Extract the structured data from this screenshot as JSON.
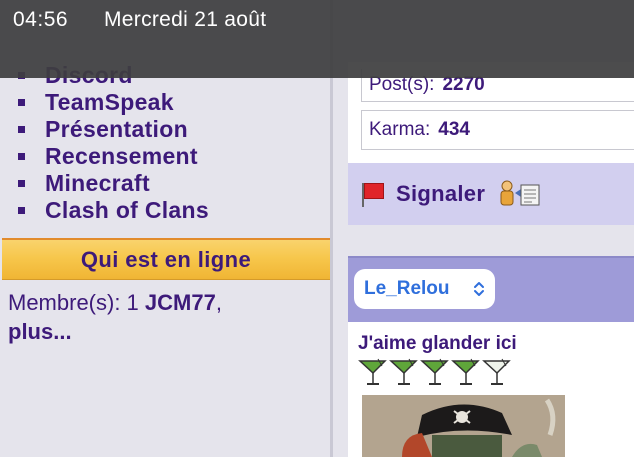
{
  "status_bar": {
    "time": "04:56",
    "date": "Mercredi 21 août"
  },
  "sidebar": {
    "items": [
      {
        "label": "Discord"
      },
      {
        "label": "TeamSpeak"
      },
      {
        "label": "Présentation"
      },
      {
        "label": "Recensement"
      },
      {
        "label": "Minecraft"
      },
      {
        "label": "Clash of Clans"
      }
    ]
  },
  "online": {
    "title": "Qui est en ligne",
    "members_label": "Membre(s): 1",
    "member_name": "JCM77",
    "separator": ",",
    "more_link": "plus..."
  },
  "profile": {
    "posts_label": "Post(s):",
    "posts_value": "2270",
    "karma_label": "Karma:",
    "karma_value": "434"
  },
  "report": {
    "label": "Signaler",
    "flag_icon": "flag-icon",
    "user_icon": "report-user-icon"
  },
  "post": {
    "username": "Le_Relou",
    "user_title": "J'aime glander ici",
    "rank": {
      "filled": 4,
      "total": 5,
      "icon": "cocktail-glass-icon"
    }
  },
  "colors": {
    "accent": "#3d1a7a",
    "link_blue": "#2f6fdc",
    "header_orange": "#f7c74c",
    "report_bg": "#d2cfef",
    "post_header_bg": "#9e9bd8"
  }
}
